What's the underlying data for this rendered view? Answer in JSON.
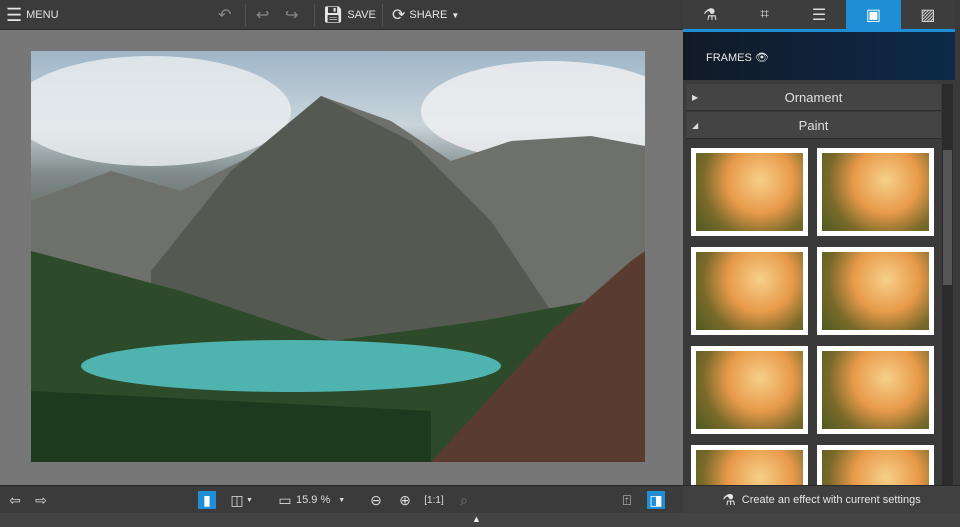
{
  "toolbar": {
    "menu": "MENU",
    "save": "SAVE",
    "share": "SHARE"
  },
  "panel": {
    "tabs": [
      "flask-icon",
      "crop-icon",
      "sliders-icon",
      "frames-icon",
      "texture-icon"
    ],
    "active_tab": 3,
    "section_title": "FRAMES",
    "categories": [
      {
        "label": "Ornament",
        "expanded": false
      },
      {
        "label": "Paint",
        "expanded": true
      }
    ]
  },
  "bottom": {
    "zoom": "15.9 %",
    "create_effect": "Create an effect with current settings"
  },
  "colors": {
    "accent": "#1e8fd6"
  }
}
